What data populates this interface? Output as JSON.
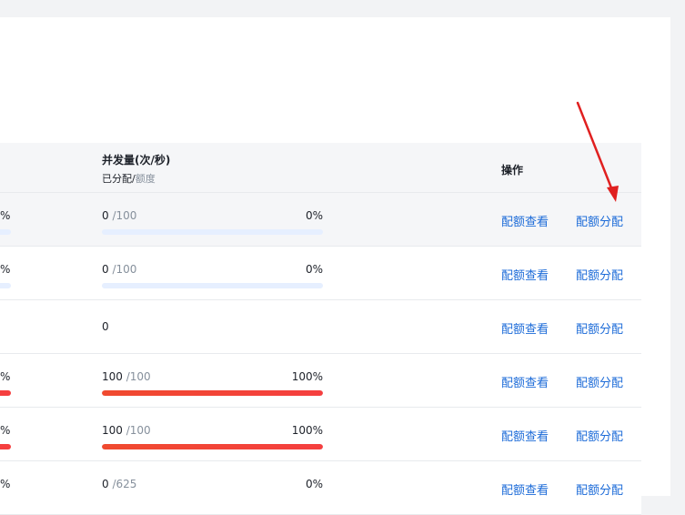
{
  "header": {
    "concurrency_title": "并发量(次/秒)",
    "sub_allocated": "已分配/",
    "sub_quota": "额度",
    "operations": "操作"
  },
  "rows": [
    {
      "left_pct": "%",
      "used": "0",
      "total": "/100",
      "pct": "0%",
      "view": "配额查看",
      "alloc": "配额分配"
    },
    {
      "left_pct": "%",
      "used": "0",
      "total": "/100",
      "pct": "0%",
      "view": "配额查看",
      "alloc": "配额分配"
    },
    {
      "left_pct": "",
      "used": "0",
      "total": "",
      "pct": "",
      "view": "配额查看",
      "alloc": "配额分配"
    },
    {
      "left_pct": "%",
      "used": "100",
      "total": "/100",
      "pct": "100%",
      "view": "配额查看",
      "alloc": "配额分配"
    },
    {
      "left_pct": "%",
      "used": "100",
      "total": "/100",
      "pct": "100%",
      "view": "配额查看",
      "alloc": "配额分配"
    },
    {
      "left_pct": "%",
      "used": "0",
      "total": "/625",
      "pct": "0%",
      "view": "配额查看",
      "alloc": "配额分配"
    }
  ],
  "progress": [
    0,
    0,
    null,
    1,
    1,
    0
  ],
  "left_bar_status": [
    "normal",
    "normal",
    "none",
    "full",
    "full",
    "none"
  ],
  "colors": {
    "link": "#1c6bd8",
    "bar_full": "#f53f3f",
    "bar_track": "#e6efff",
    "annotation_arrow": "#e02020"
  },
  "icons": {
    "annotation": "red-arrow-pointing-to-allocate"
  }
}
